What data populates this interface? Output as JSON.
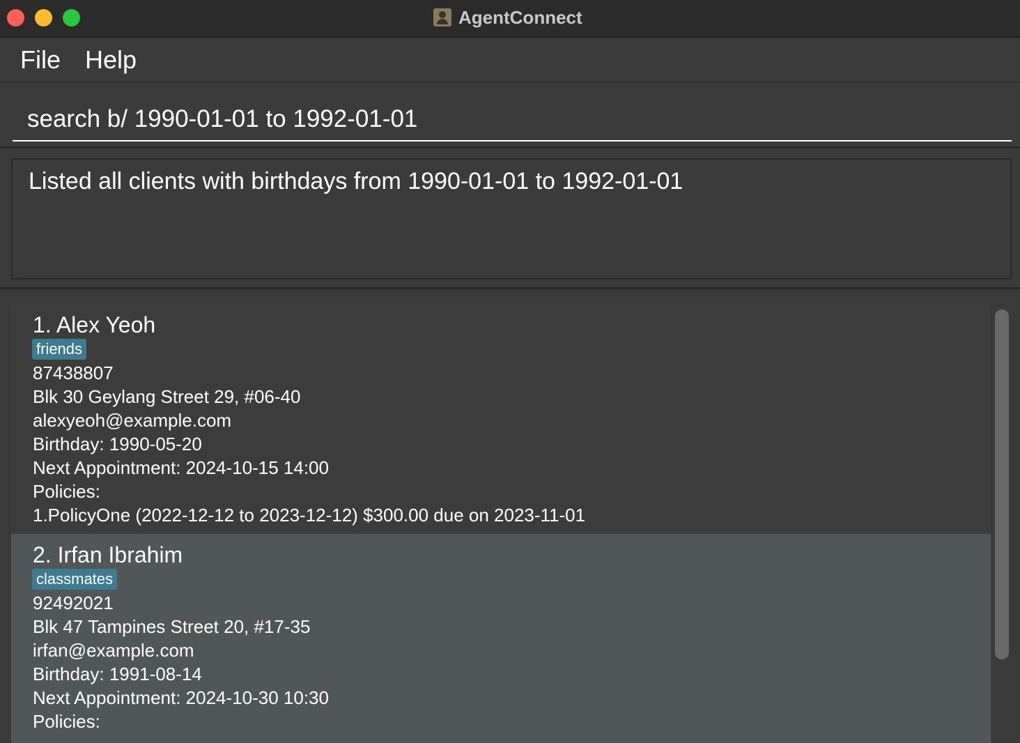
{
  "window": {
    "title": "AgentConnect"
  },
  "menu": {
    "file": "File",
    "help": "Help"
  },
  "command": {
    "value": "search b/ 1990-01-01 to 1992-01-01"
  },
  "result": {
    "text": "Listed all clients with birthdays from 1990-01-01 to 1992-01-01"
  },
  "persons": [
    {
      "name": "1. Alex Yeoh",
      "tag": "friends",
      "phone": "87438807",
      "address": "Blk 30 Geylang Street 29, #06-40",
      "email": "alexyeoh@example.com",
      "birthday": "Birthday: 1990-05-20",
      "appointment": "Next Appointment: 2024-10-15 14:00",
      "policies_label": "Policies:",
      "policies": [
        "1.PolicyOne (2022-12-12 to 2023-12-12) $300.00 due on 2023-11-01"
      ]
    },
    {
      "name": "2. Irfan Ibrahim",
      "tag": "classmates",
      "phone": "92492021",
      "address": "Blk 47 Tampines Street 20, #17-35",
      "email": "irfan@example.com",
      "birthday": "Birthday: 1991-08-14",
      "appointment": "Next Appointment: 2024-10-30 10:30",
      "policies_label": "Policies:",
      "policies": []
    }
  ],
  "colors": {
    "tag_bg": "#3e7b91",
    "selected_card_bg": "#515659",
    "close": "#fe5f57",
    "minimize": "#febc2e",
    "maximize": "#28c840"
  }
}
